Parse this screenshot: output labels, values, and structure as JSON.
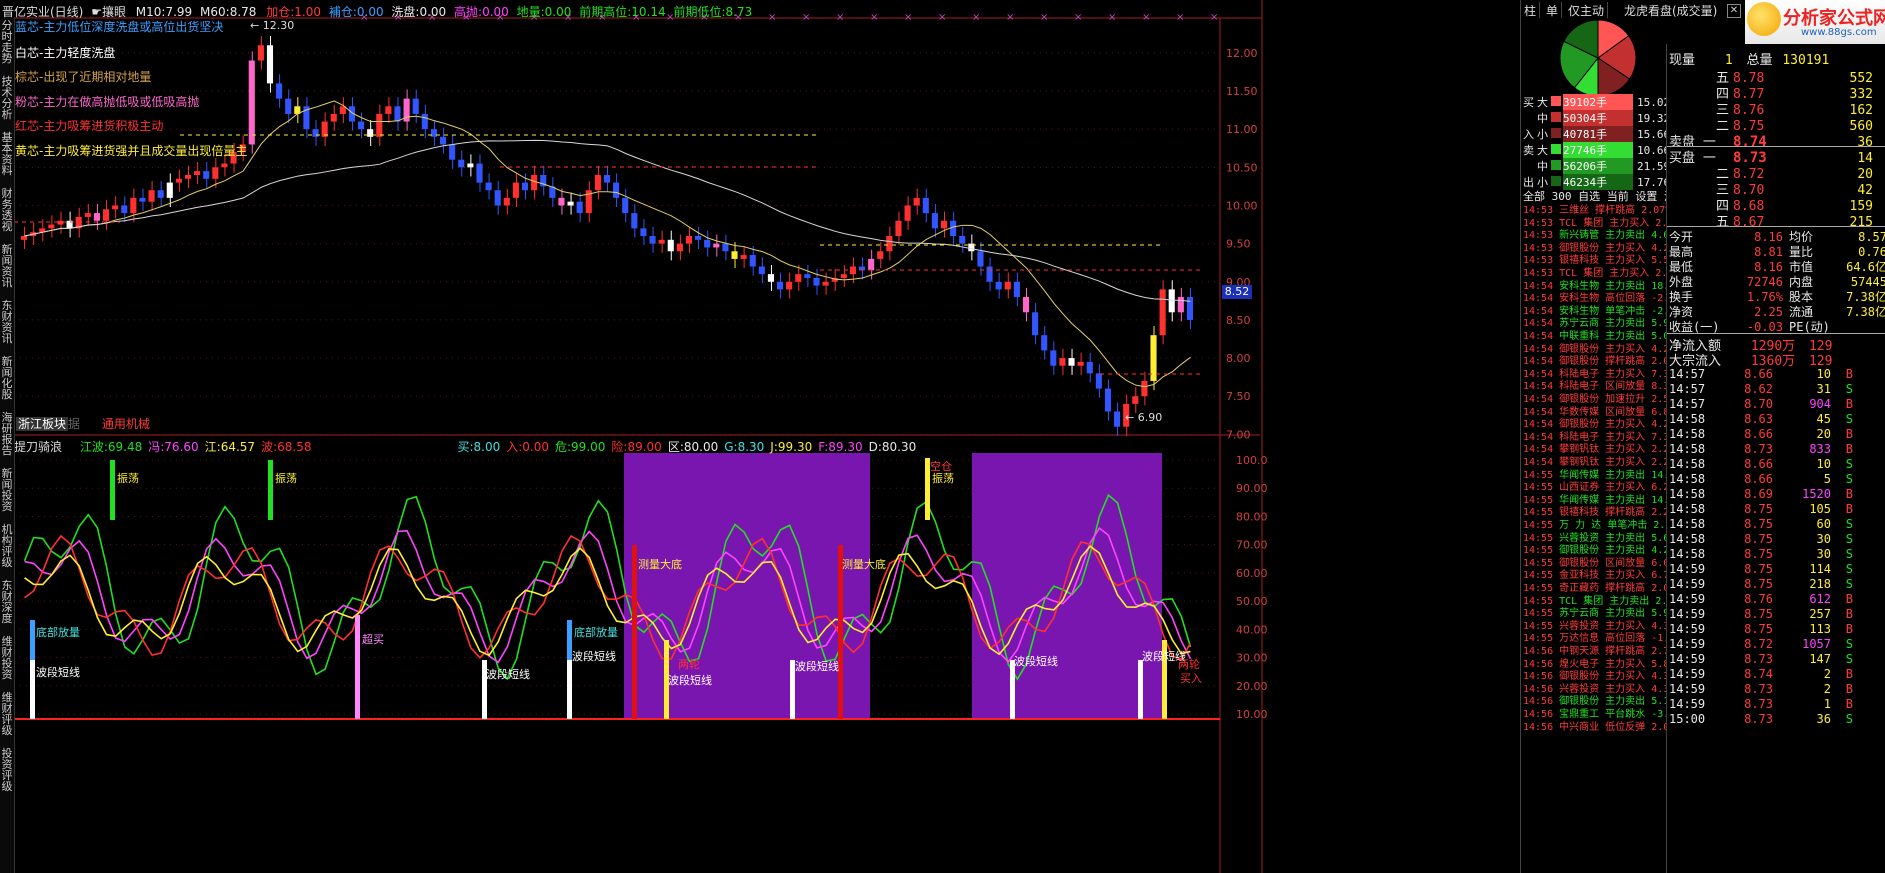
{
  "top_bar": {
    "title": "晋亿实业(日线)",
    "menu_label": "☛攘眼",
    "ma10_label": "M10:",
    "ma10": "7.99",
    "ma60_label": "M60:",
    "ma60": "8.78",
    "jiacang_label": "加仓:",
    "jiacang": "1.00",
    "bucang_label": "補仓:",
    "bucang": "0.00",
    "xipan_label": "洗盘:",
    "xipan": "0.00",
    "gaopao_label": "高抛:",
    "gaopao": "0.00",
    "dibang_label": "地量:",
    "dibang": "0.00",
    "qgao_label": "前期高位:",
    "qgao": "10.14",
    "qdi_label": "前期低位:",
    "qdi": "8.73"
  },
  "legend": [
    {
      "text": "蓝芯-主力低位深度洗盘或高位出货坚决",
      "color": "#3ba0ff"
    },
    {
      "text": "白芯-主力轻度洗盘",
      "color": "#ffffff"
    },
    {
      "text": "棕芯-出现了近期相对地量",
      "color": "#d4a24a"
    },
    {
      "text": "粉芯-主力在做高抛低吸或低吸高抛",
      "color": "#ff66cc"
    },
    {
      "text": "红芯-主力吸筹进货积极主动",
      "color": "#ff3030"
    },
    {
      "text": "黄芯-主力吸筹进货强并且成交量出现倍量主",
      "color": "#ffee33"
    }
  ],
  "main_chart": {
    "price_axis": [
      "12.00",
      "11.50",
      "11.00",
      "10.50",
      "10.00",
      "9.50",
      "9.00",
      "8.50",
      "8.00",
      "7.50",
      "7.00"
    ],
    "current_price_label": "8.52",
    "high_label": "12.30",
    "low_label": "6.90",
    "bottom_tags": [
      "浙江板块",
      "通用机械"
    ],
    "bottom_tag_faded": "据"
  },
  "sub_chart": {
    "title": "提刀骑浪",
    "values": [
      {
        "label": "江波:",
        "value": "69.48",
        "color": "#20e020"
      },
      {
        "label": "冯:",
        "value": "76.60",
        "color": "#ff44ff"
      },
      {
        "label": "江:",
        "value": "64.57",
        "color": "#ffee33"
      },
      {
        "label": "波:",
        "value": "68.58",
        "color": "#ff3030"
      },
      {
        "label": "买:",
        "value": "8.00",
        "color": "#3ee0e0"
      },
      {
        "label": "入:",
        "value": "0.00",
        "color": "#ff3030"
      },
      {
        "label": "危:",
        "value": "99.00",
        "color": "#20e020"
      },
      {
        "label": "险:",
        "value": "89.00",
        "color": "#ff3030"
      },
      {
        "label": "区:",
        "value": "80.00",
        "color": "#e8e8e8"
      },
      {
        "label": "G:",
        "value": "8.30",
        "color": "#3ee0e0"
      },
      {
        "label": "J:",
        "value": "99.30",
        "color": "#ffee33"
      },
      {
        "label": "F:",
        "value": "89.30",
        "color": "#ff44ff"
      },
      {
        "label": "D:",
        "value": "80.30",
        "color": "#e8e8e8"
      }
    ],
    "axis": [
      "100.0",
      "90.00",
      "80.00",
      "70.00",
      "60.00",
      "50.00",
      "40.00",
      "30.00",
      "20.00",
      "10.00"
    ],
    "annotations": {
      "zhendang": "振荡",
      "dibu": "底部放量",
      "boduan": "波段短线",
      "chaomai": "超买",
      "celiang": "测量大底",
      "lianglun": "两轮",
      "kongcang": "空仓",
      "mairu": "买入"
    }
  },
  "left_nav": [
    "分时走势",
    "技术分析",
    "基本资料",
    "财务透视",
    "新闻资讯",
    "东财资讯",
    "新闻化股",
    "海研报告",
    "新闻投资",
    "机构评级",
    "东财深度",
    "维财投资",
    "维财评级",
    "投资评级"
  ],
  "right_panel": {
    "tabs": [
      "柱",
      "单",
      "仅主动",
      "龙虎看盘(成交量)"
    ],
    "logo": "分析家公式网",
    "logo_url": "www.88gs.com",
    "flows": [
      {
        "side": "买",
        "size": "大",
        "value": "39102手",
        "pct": "15.02%",
        "color": "#ff5555"
      },
      {
        "side": "",
        "size": "中",
        "value": "50304手",
        "pct": "19.32%",
        "color": "#c23030"
      },
      {
        "side": "入",
        "size": "小",
        "value": "40781手",
        "pct": "15.66%",
        "color": "#802020"
      },
      {
        "side": "卖",
        "size": "大",
        "value": "27746手",
        "pct": "10.66%",
        "color": "#33dd33"
      },
      {
        "side": "",
        "size": "中",
        "value": "56206手",
        "pct": "21.59%",
        "color": "#229922"
      },
      {
        "side": "出",
        "size": "小",
        "value": "46234手",
        "pct": "17.76%",
        "color": "#156615"
      }
    ],
    "filter_tabs": "全部 300 自选 当前 设置 浮出 折",
    "vol_now_label": "现量",
    "vol_now": "1",
    "vol_total_label": "总量",
    "vol_total": "130191",
    "sells": [
      {
        "lvl": "五",
        "price": "8.78",
        "vol": "552"
      },
      {
        "lvl": "四",
        "price": "8.77",
        "vol": "332"
      },
      {
        "lvl": "三",
        "price": "8.76",
        "vol": "162"
      },
      {
        "lvl": "二",
        "price": "8.75",
        "vol": "560"
      },
      {
        "lvl": "卖盘 一",
        "price": "8.74",
        "vol": "36"
      }
    ],
    "buys": [
      {
        "lvl": "买盘 一",
        "price": "8.73",
        "vol": "14"
      },
      {
        "lvl": "二",
        "price": "8.72",
        "vol": "20"
      },
      {
        "lvl": "三",
        "price": "8.70",
        "vol": "42"
      },
      {
        "lvl": "四",
        "price": "8.68",
        "vol": "159"
      },
      {
        "lvl": "五",
        "price": "8.67",
        "vol": "215"
      }
    ],
    "stats": [
      [
        "今开",
        "8.16",
        "均价",
        "8.57"
      ],
      [
        "最高",
        "8.81",
        "量比",
        "0.76"
      ],
      [
        "最低",
        "8.16",
        "市值",
        "64.6亿"
      ],
      [
        "外盘",
        "72746",
        "内盘",
        "57445"
      ],
      [
        "换手",
        "1.76%",
        "股本",
        "7.38亿"
      ],
      [
        "净资",
        "2.25",
        "流通",
        "7.38亿"
      ],
      [
        "收益(一)",
        "-0.03",
        "PE(动)",
        ""
      ]
    ],
    "flow_in_label": "净流入额",
    "flow_in": "1290万",
    "flow_in_extra": "129",
    "block_in_label": "大宗流入",
    "block_in": "1360万",
    "block_in_extra": "129",
    "ticks": [
      [
        "14:57",
        "8.66",
        "10",
        "B"
      ],
      [
        "14:57",
        "8.62",
        "31",
        "S"
      ],
      [
        "14:57",
        "8.70",
        "904",
        "B"
      ],
      [
        "14:58",
        "8.63",
        "45",
        "S"
      ],
      [
        "14:58",
        "8.66",
        "20",
        "B"
      ],
      [
        "14:58",
        "8.73",
        "833",
        "B"
      ],
      [
        "14:58",
        "8.66",
        "10",
        "S"
      ],
      [
        "14:58",
        "8.66",
        "5",
        "S"
      ],
      [
        "14:58",
        "8.69",
        "1520",
        "B"
      ],
      [
        "14:58",
        "8.75",
        "105",
        "B"
      ],
      [
        "14:58",
        "8.75",
        "60",
        "S"
      ],
      [
        "14:58",
        "8.75",
        "30",
        "S"
      ],
      [
        "14:58",
        "8.75",
        "30",
        "S"
      ],
      [
        "14:59",
        "8.75",
        "114",
        "S"
      ],
      [
        "14:59",
        "8.75",
        "218",
        "S"
      ],
      [
        "14:59",
        "8.76",
        "612",
        "B"
      ],
      [
        "14:59",
        "8.75",
        "257",
        "B"
      ],
      [
        "14:59",
        "8.75",
        "113",
        "B"
      ],
      [
        "14:59",
        "8.72",
        "1057",
        "S"
      ],
      [
        "14:59",
        "8.73",
        "147",
        "S"
      ],
      [
        "14:59",
        "8.74",
        "2",
        "B"
      ],
      [
        "14:59",
        "8.73",
        "2",
        "B"
      ],
      [
        "14:59",
        "8.73",
        "1",
        "B"
      ],
      [
        "15:00",
        "8.73",
        "36",
        "S"
      ]
    ],
    "news": [
      [
        "14:53",
        "三维丝",
        "撑杆跳高",
        "2.07%"
      ],
      [
        "14:53",
        "TCL 集团",
        "主力买入",
        "2.20/1"
      ],
      [
        "14:53",
        "新兴铸管",
        "主力卖出",
        "4.60/3"
      ],
      [
        "14:53",
        "御银股份",
        "主力买入",
        "4.22/1"
      ],
      [
        "14:53",
        "银禧科技",
        "主力买入",
        "5.50/3"
      ],
      [
        "14:53",
        "TCL 集团",
        "主力买入",
        "2.20/1"
      ],
      [
        "14:54",
        "安科生物",
        "主力卖出",
        "18.50"
      ],
      [
        "14:54",
        "安科生物",
        "高位回落",
        "-2.75"
      ],
      [
        "14:54",
        "安科生物",
        "单笔冲击",
        "-2.20"
      ],
      [
        "14:54",
        "苏宁云商",
        "主力卖出",
        "5.90/3"
      ],
      [
        "14:54",
        "中联重科",
        "主力卖出",
        "5.05/"
      ],
      [
        "14:54",
        "御银股份",
        "主力买入",
        "4.22/1"
      ],
      [
        "14:54",
        "御银股份",
        "撑杆跳高",
        "2.041"
      ],
      [
        "14:54",
        "科陆电子",
        "主力买入",
        "7.39/"
      ],
      [
        "14:54",
        "科陆电子",
        "区间放量",
        "8.36"
      ],
      [
        "14:54",
        "御银股份",
        "加速拉升",
        "2.55"
      ],
      [
        "14:54",
        "华数传媒",
        "区间放量",
        "6.84"
      ],
      [
        "14:54",
        "御银股份",
        "主力买入",
        "4.22/"
      ],
      [
        "14:54",
        "科陆电子",
        "主力买入",
        "7.38/"
      ],
      [
        "14:54",
        "攀钢钒钛",
        "主力买入",
        "2.22/"
      ],
      [
        "14:54",
        "攀钢钒钛",
        "主力买入",
        "2.22/"
      ],
      [
        "14:55",
        "华闻传媒",
        "主力卖出",
        "14.25"
      ],
      [
        "14:55",
        "山西证券",
        "主力买入",
        "6.25/"
      ],
      [
        "14:55",
        "华闻传媒",
        "主力卖出",
        "14.20"
      ],
      [
        "14:55",
        "银禧科技",
        "撑杆跳高",
        "2.286"
      ],
      [
        "14:55",
        "万 力 达",
        "单笔冲击",
        "2.152"
      ],
      [
        "14:55",
        "兴蓉投资",
        "主力卖出",
        "5.66/"
      ],
      [
        "14:55",
        "御银股份",
        "主力卖出",
        "4.29/"
      ],
      [
        "14:55",
        "御银股份",
        "区间放量",
        "6.053"
      ],
      [
        "14:55",
        "金亚科技",
        "主力买入",
        "6.79/"
      ],
      [
        "14:55",
        "奇正藏药",
        "撑杆跳高",
        "2.052"
      ],
      [
        "14:55",
        "TCL 集团",
        "主力卖出",
        "2.20/"
      ],
      [
        "14:55",
        "苏宁云商",
        "主力卖出",
        "5.91/"
      ],
      [
        "14:55",
        "兴蓉投资",
        "主力买入",
        "4.30/"
      ],
      [
        "14:55",
        "万达信息",
        "高位回落",
        "-1.84"
      ],
      [
        "14:56",
        "中钢天源",
        "撑杆跳高",
        "2.769"
      ],
      [
        "14:56",
        "煌火电子",
        "主力买入",
        "5.80/"
      ],
      [
        "14:56",
        "御银股份",
        "主力买入",
        "4.31/"
      ],
      [
        "14:56",
        "兴蓉投资",
        "主力买入",
        "4.31/"
      ],
      [
        "14:56",
        "御银股份",
        "主力卖出",
        "5.11/"
      ],
      [
        "14:56",
        "宝鼎重工",
        "平台跳水",
        "-3.00"
      ],
      [
        "14:56",
        "中兴商业",
        "低位反弹",
        "2.049"
      ]
    ]
  },
  "colors": {
    "up": "#ff3030",
    "down": "#3355ff",
    "bg": "#000000",
    "grid": "#8a1b1b",
    "purple": "#7a16b0"
  }
}
